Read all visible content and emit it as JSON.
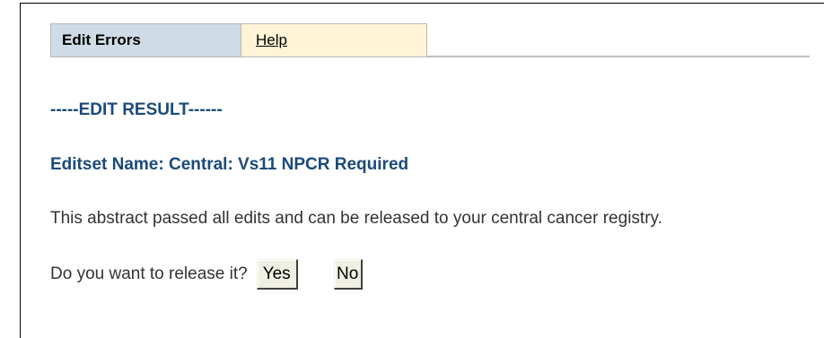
{
  "tabs": {
    "edit_errors": "Edit Errors",
    "help": "Help"
  },
  "result_heading": "-----EDIT RESULT------",
  "editset_heading": "Editset Name: Central: Vs11 NPCR Required",
  "message": "This abstract passed all edits and can be released to your central cancer registry.",
  "prompt": {
    "question": "Do you want to release it?",
    "yes_label": "Yes",
    "no_label": "No"
  }
}
